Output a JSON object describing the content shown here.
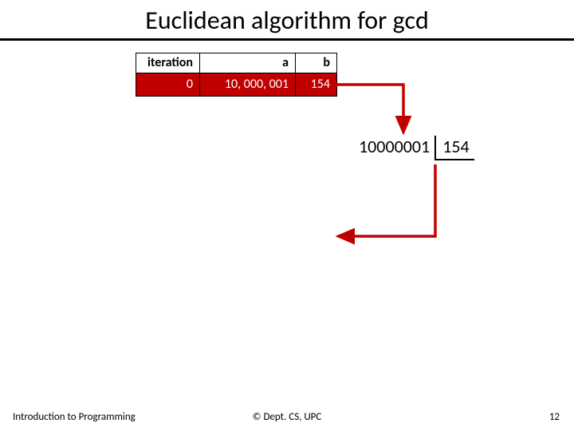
{
  "title": "Euclidean algorithm for gcd",
  "table": {
    "headers": {
      "iteration": "iteration",
      "a": "a",
      "b": "b"
    },
    "rows": [
      {
        "iteration": "0",
        "a": "10, 000, 001",
        "b": "154"
      }
    ]
  },
  "division": {
    "dividend": "10000001",
    "divisor": "154"
  },
  "footer": {
    "left": "Introduction to Programming",
    "center": "© Dept. CS, UPC",
    "page": "12"
  },
  "chart_data": {
    "type": "table",
    "title": "Euclidean algorithm for gcd",
    "columns": [
      "iteration",
      "a",
      "b"
    ],
    "rows": [
      [
        0,
        10000001,
        154
      ]
    ],
    "annotations": {
      "long_division": {
        "dividend": 10000001,
        "divisor": 154
      }
    }
  }
}
